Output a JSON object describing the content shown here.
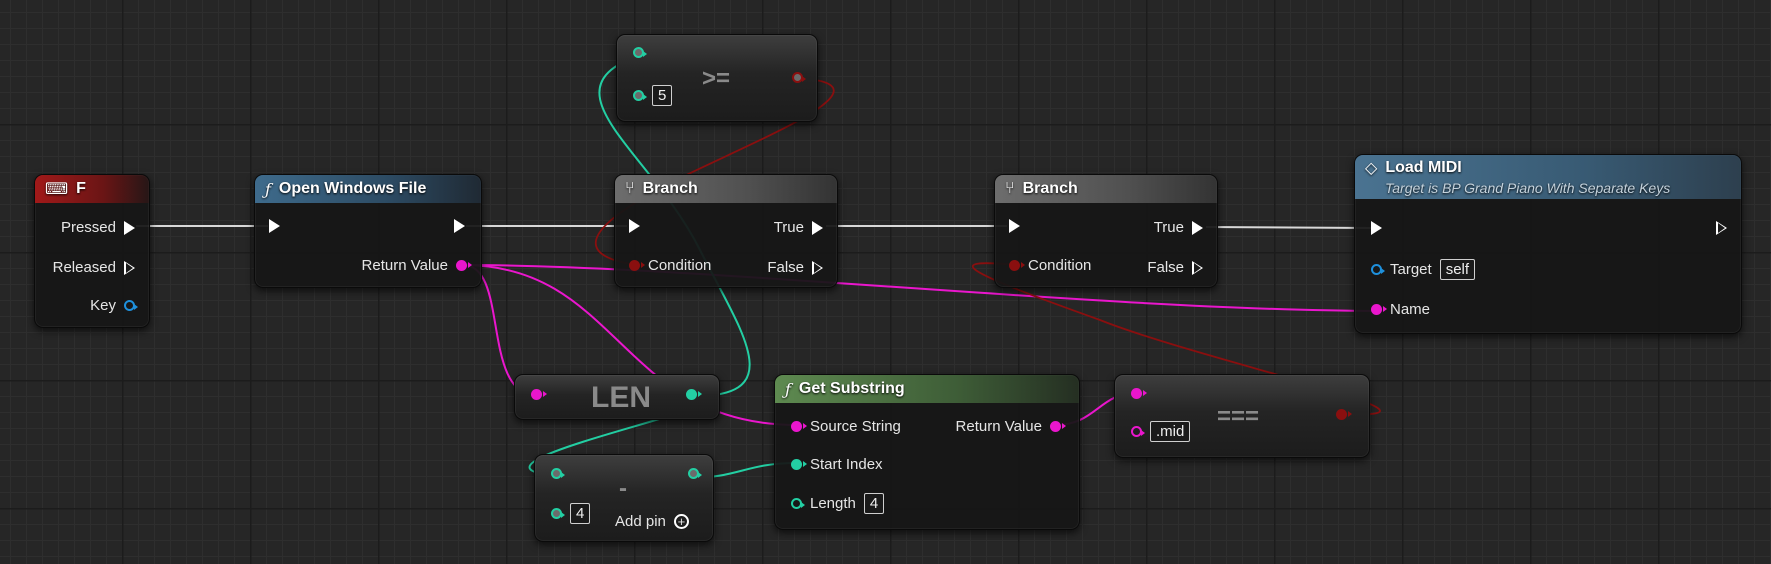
{
  "colors": {
    "exec": "#ffffff",
    "string": "#ea16cd",
    "bool": "#8a0f0f",
    "int": "#23cfa3",
    "object": "#1e90dc",
    "event_header": "#a11919",
    "function_header": "#3e6b8c",
    "pure_header": "#5e8a50",
    "branch_header": "#6d6d6d"
  },
  "nodes": {
    "key_event": {
      "icon": "keyboard-icon",
      "title": "F",
      "pins": {
        "pressed": "Pressed",
        "released": "Released",
        "key": "Key"
      }
    },
    "open_windows_file": {
      "icon": "function-icon",
      "title": "Open Windows File",
      "pins": {
        "return_value": "Return Value"
      }
    },
    "compare_ge": {
      "operator": ">=",
      "b_value": "5"
    },
    "branch1": {
      "icon": "branch-icon",
      "title": "Branch",
      "pins": {
        "condition": "Condition",
        "true": "True",
        "false": "False"
      }
    },
    "branch2": {
      "icon": "branch-icon",
      "title": "Branch",
      "pins": {
        "condition": "Condition",
        "true": "True",
        "false": "False"
      }
    },
    "load_midi": {
      "icon": "message-icon",
      "title": "Load MIDI",
      "subtitle": "Target is BP Grand Piano With Separate Keys",
      "pins": {
        "target": "Target",
        "target_value": "self",
        "name": "Name"
      }
    },
    "len": {
      "operator": "LEN"
    },
    "subtract": {
      "operator": "-",
      "b_value": "4",
      "add_pin": "Add pin"
    },
    "get_substring": {
      "icon": "function-icon",
      "title": "Get Substring",
      "pins": {
        "source_string": "Source String",
        "return_value": "Return Value",
        "start_index": "Start Index",
        "length": "Length",
        "length_value": "4"
      }
    },
    "equal_string": {
      "operator": "===",
      "b_value": ".mid"
    }
  }
}
